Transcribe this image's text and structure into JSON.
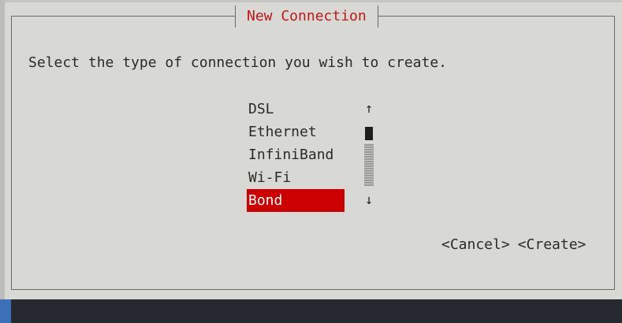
{
  "dialog": {
    "title": "New Connection",
    "prompt": "Select the type of connection you wish to create."
  },
  "connection_types": {
    "items": [
      "DSL",
      "Ethernet",
      "InfiniBand",
      "Wi-Fi",
      "Bond"
    ],
    "selected": "Bond"
  },
  "scrollbar": {
    "up_arrow": "↑",
    "down_arrow": "↓"
  },
  "buttons": {
    "cancel": "<Cancel>",
    "create": "<Create>"
  },
  "colors": {
    "title": "#c01818",
    "selection_bg": "#cc0000",
    "selection_fg": "#ffffff",
    "background": "#d8d8d5"
  }
}
